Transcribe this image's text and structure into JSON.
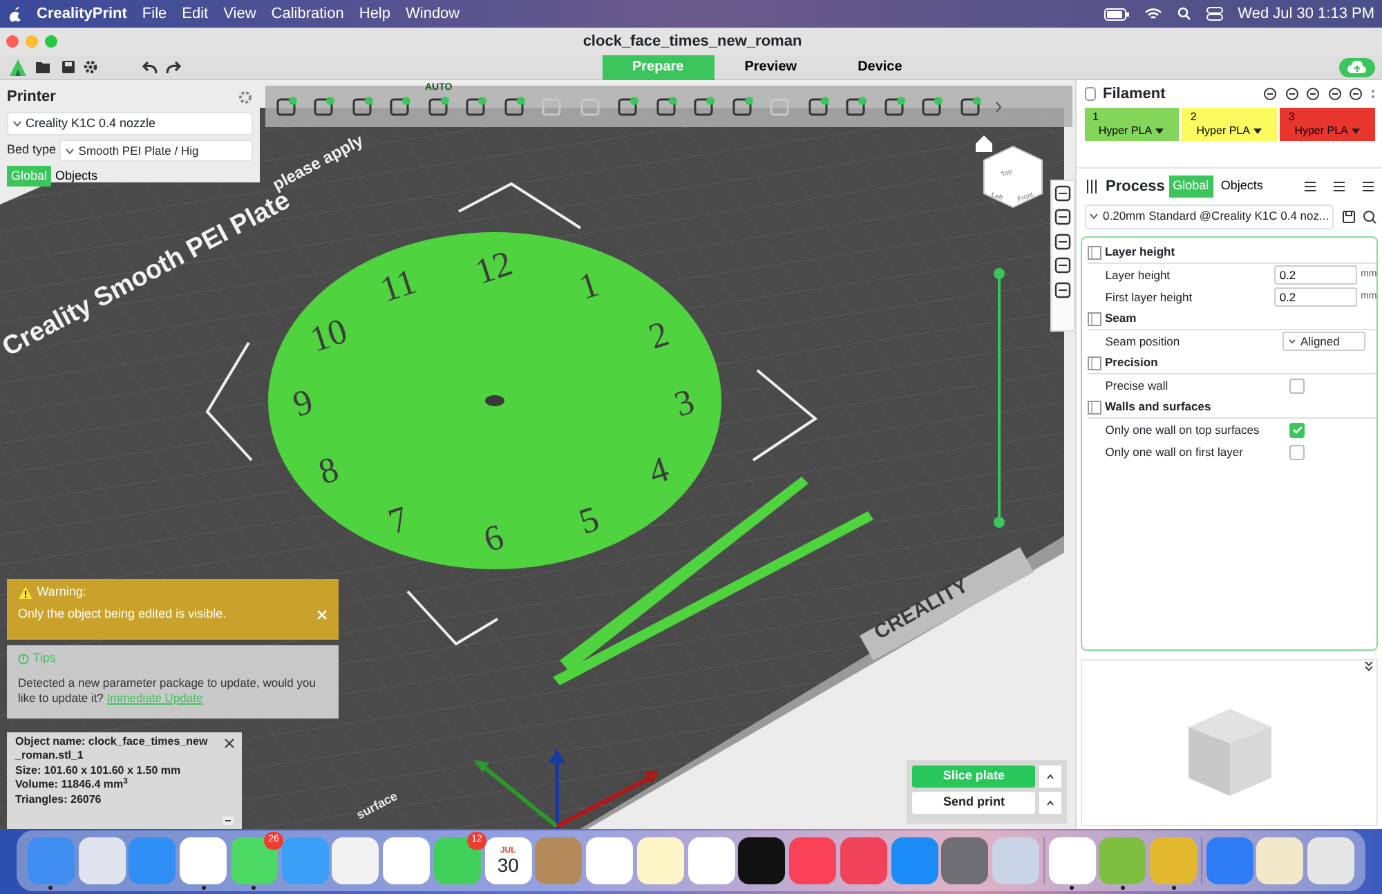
{
  "menubar": {
    "app": "CrealityPrint",
    "menus": [
      "File",
      "Edit",
      "View",
      "Calibration",
      "Help",
      "Window"
    ],
    "clock": "Wed Jul 30  1:13 PM"
  },
  "window": {
    "title": "clock_face_times_new_roman"
  },
  "tabs": [
    {
      "label": "Prepare",
      "selected": true
    },
    {
      "label": "Preview",
      "selected": false
    },
    {
      "label": "Device",
      "selected": false
    }
  ],
  "printer": {
    "title": "Printer",
    "model": "Creality K1C 0.4 nozzle",
    "bed_type_label": "Bed type",
    "bed_type": "Smooth PEI Plate / Hig",
    "scope_tabs": [
      {
        "label": "Global",
        "selected": true
      },
      {
        "label": "Objects",
        "selected": false
      }
    ]
  },
  "toolbar": {
    "auto_label": "AUTO",
    "tools": [
      {
        "disabled": false
      },
      {
        "disabled": false
      },
      {
        "disabled": false
      },
      {
        "disabled": false
      },
      {
        "disabled": false
      },
      {
        "disabled": false
      },
      {
        "disabled": false
      },
      {
        "disabled": true
      },
      {
        "disabled": true
      },
      {
        "disabled": false
      },
      {
        "disabled": false
      },
      {
        "disabled": false
      },
      {
        "disabled": false
      },
      {
        "disabled": true
      },
      {
        "disabled": false
      },
      {
        "disabled": false
      },
      {
        "disabled": false
      },
      {
        "disabled": false
      },
      {
        "disabled": false
      }
    ]
  },
  "plate": {
    "name": "Creality Smooth PEI Plate",
    "note": "please apply",
    "brand": "CREALITY",
    "surface": "surface",
    "view_cube": [
      "Top",
      "Left",
      "Front"
    ]
  },
  "clock_numbers": [
    "12",
    "1",
    "2",
    "3",
    "4",
    "5",
    "6",
    "7",
    "8",
    "9",
    "10",
    "11"
  ],
  "filament": {
    "title": "Filament",
    "slots": [
      {
        "number": "1",
        "material": "Hyper PLA",
        "color": "#84d65a"
      },
      {
        "number": "2",
        "material": "Hyper PLA",
        "color": "#fbfb5f"
      },
      {
        "number": "3",
        "material": "Hyper PLA",
        "color": "#e8362f"
      }
    ]
  },
  "process": {
    "title": "Process",
    "scope_tabs": [
      {
        "label": "Global",
        "selected": true
      },
      {
        "label": "Objects",
        "selected": false
      }
    ],
    "preset": "0.20mm Standard @Creality K1C 0.4 noz...",
    "groups": [
      {
        "title": "Layer height",
        "options": [
          {
            "kind": "number",
            "label": "Layer height",
            "value": "0.2",
            "unit": "mm"
          },
          {
            "kind": "number",
            "label": "First layer height",
            "value": "0.2",
            "unit": "mm"
          }
        ]
      },
      {
        "title": "Seam",
        "options": [
          {
            "kind": "select",
            "label": "Seam position",
            "value": "Aligned"
          }
        ]
      },
      {
        "title": "Precision",
        "options": [
          {
            "kind": "checkbox",
            "label": "Precise wall",
            "checked": false
          }
        ]
      },
      {
        "title": "Walls and surfaces",
        "options": [
          {
            "kind": "checkbox",
            "label": "Only one wall on top surfaces",
            "checked": true
          },
          {
            "kind": "checkbox",
            "label": "Only one wall on first layer",
            "checked": false
          }
        ]
      }
    ]
  },
  "warning": {
    "title": "Warning:",
    "text": "Only the object being edited is visible."
  },
  "tips": {
    "title": "Tips",
    "text": "Detected a new parameter package to update, would you like to update it?",
    "link": "Immediate Update"
  },
  "object_info": [
    "Object name: clock_face_times_new_roman.stl_1",
    "Size: 101.60 x 101.60 x 1.50 mm",
    "Volume: 11846.4 mm$^{3}$",
    "Triangles: 26076"
  ],
  "actions": [
    {
      "label": "Slice plate",
      "primary": true
    },
    {
      "label": "Send print",
      "primary": false
    }
  ],
  "dock": [
    {
      "color": "#3d8ef0",
      "running": true
    },
    {
      "color": "#e0e4ee",
      "running": false
    },
    {
      "color": "#2f8ff5",
      "running": false
    },
    {
      "color": "#ffffff",
      "running": true
    },
    {
      "color": "#4cd964",
      "running": true,
      "badge": "26"
    },
    {
      "color": "#3aa0f7",
      "running": false
    },
    {
      "color": "#f2f2f2",
      "running": false
    },
    {
      "color": "#ffffff",
      "running": false
    },
    {
      "color": "#3fd15a",
      "running": false,
      "badge": "12"
    },
    {
      "color": "#ffffff",
      "running": false,
      "month": "JUL",
      "day": "30"
    },
    {
      "color": "#b48a5a",
      "running": false
    },
    {
      "color": "#ffffff",
      "running": false
    },
    {
      "color": "#fff6c8",
      "running": false
    },
    {
      "color": "#ffffff",
      "running": false
    },
    {
      "color": "#111111",
      "running": false
    },
    {
      "color": "#fa4158",
      "running": false
    },
    {
      "color": "#f0435a",
      "running": false
    },
    {
      "color": "#1b8cf5",
      "running": false
    },
    {
      "color": "#6e6e73",
      "running": false
    },
    {
      "color": "#c9d4e6",
      "running": false
    },
    {
      "color": "#ffffff",
      "running": true
    },
    {
      "color": "#7fbf3f",
      "running": true
    },
    {
      "color": "#e2b92e",
      "running": true
    },
    {
      "color": "#2e7cf6",
      "running": false
    },
    {
      "color": "#f1e9c9",
      "running": false
    },
    {
      "color": "#e6e6e6",
      "running": false
    }
  ]
}
